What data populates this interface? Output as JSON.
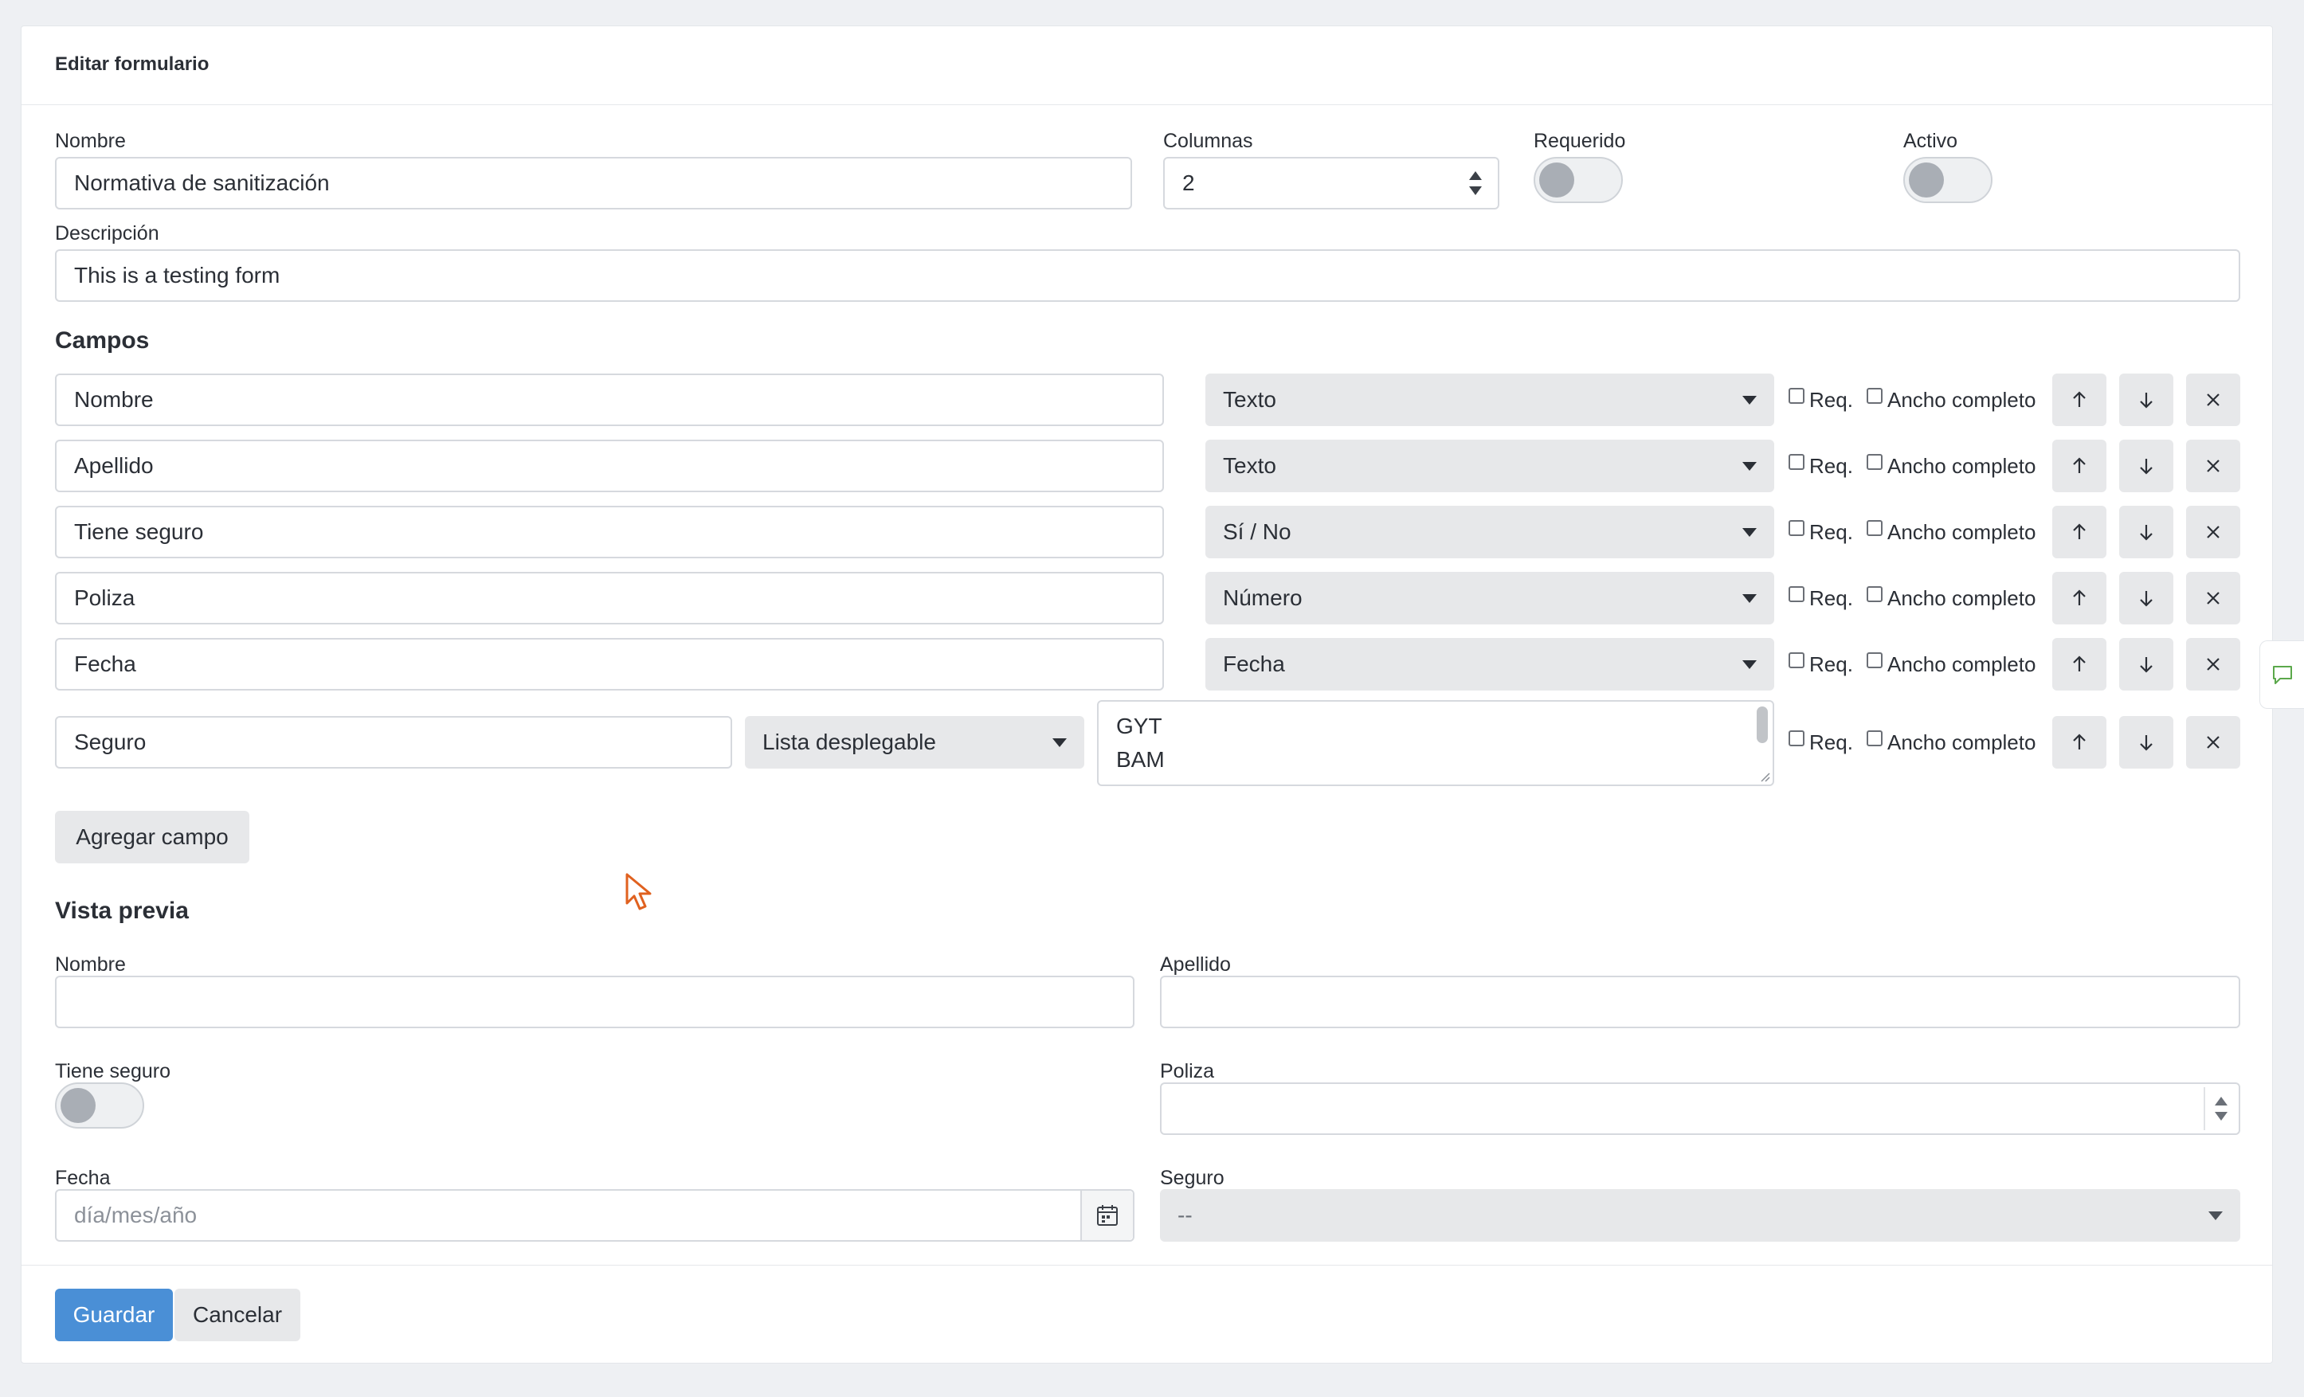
{
  "header": {
    "title": "Editar formulario"
  },
  "form": {
    "name_label": "Nombre",
    "name_value": "Normativa de sanitización",
    "columns_label": "Columnas",
    "columns_value": "2",
    "required_label": "Requerido",
    "required_on": false,
    "active_label": "Activo",
    "active_on": false,
    "description_label": "Descripción",
    "description_value": "This is a testing form"
  },
  "fields_section": {
    "title": "Campos",
    "req_label": "Req.",
    "full_width_label": "Ancho completo",
    "rows": [
      {
        "name": "Nombre",
        "type": "Texto"
      },
      {
        "name": "Apellido",
        "type": "Texto"
      },
      {
        "name": "Tiene seguro",
        "type": "Sí / No"
      },
      {
        "name": "Poliza",
        "type": "Número"
      },
      {
        "name": "Fecha",
        "type": "Fecha"
      }
    ],
    "dropdown_row": {
      "name": "Seguro",
      "type": "Lista desplegable",
      "options": [
        "GYT",
        "BAM"
      ]
    },
    "add_button": "Agregar campo"
  },
  "preview": {
    "title": "Vista previa",
    "nombre_label": "Nombre",
    "apellido_label": "Apellido",
    "tiene_seguro_label": "Tiene seguro",
    "poliza_label": "Poliza",
    "fecha_label": "Fecha",
    "fecha_placeholder": "día/mes/año",
    "seguro_label": "Seguro",
    "seguro_value": "--"
  },
  "footer": {
    "save": "Guardar",
    "cancel": "Cancelar"
  },
  "colors": {
    "primary": "#4a8fd6",
    "button_gray": "#e7e8ea",
    "border": "#d6d9de",
    "cursor": "#e0611f"
  },
  "icons": [
    "arrow-up-icon",
    "arrow-down-icon",
    "close-icon",
    "calendar-icon",
    "comment-icon",
    "cursor-icon"
  ]
}
